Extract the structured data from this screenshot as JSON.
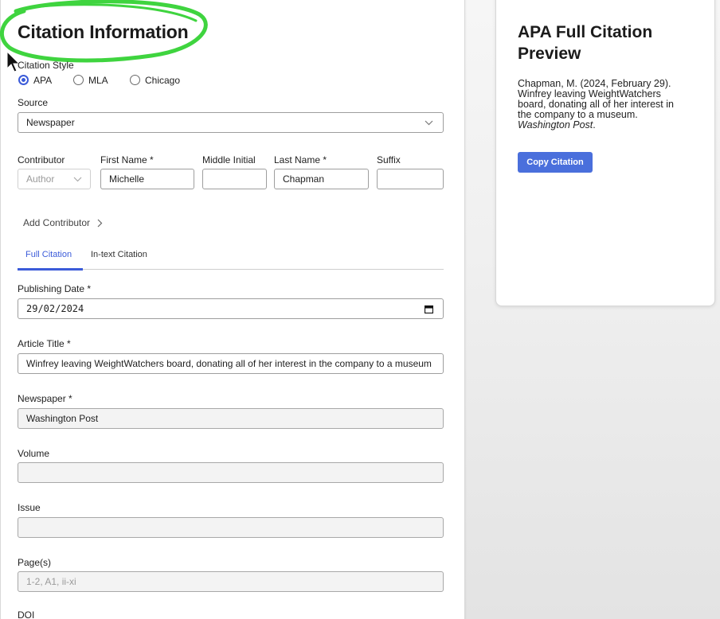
{
  "form": {
    "title": "Citation Information",
    "citation_style": {
      "label": "Citation Style",
      "options": [
        {
          "label": "APA",
          "checked": true
        },
        {
          "label": "MLA",
          "checked": false
        },
        {
          "label": "Chicago",
          "checked": false
        }
      ]
    },
    "source": {
      "label": "Source",
      "value": "Newspaper"
    },
    "contributor": {
      "label": "Contributor",
      "role_placeholder": "Author",
      "first_name_label": "First Name *",
      "first_name_value": "Michelle",
      "middle_initial_label": "Middle Initial",
      "middle_initial_value": "",
      "last_name_label": "Last Name *",
      "last_name_value": "Chapman",
      "suffix_label": "Suffix",
      "suffix_value": ""
    },
    "add_contributor": "Add Contributor",
    "tabs": [
      {
        "label": "Full Citation",
        "active": true
      },
      {
        "label": "In-text Citation",
        "active": false
      }
    ],
    "publishing_date": {
      "label": "Publishing Date *",
      "value": "29/02/2024"
    },
    "article_title": {
      "label": "Article Title *",
      "value": "Winfrey leaving WeightWatchers board, donating all of her interest in the company to a museum"
    },
    "newspaper": {
      "label": "Newspaper *",
      "value": "Washington Post"
    },
    "volume": {
      "label": "Volume",
      "value": ""
    },
    "issue": {
      "label": "Issue",
      "value": ""
    },
    "pages": {
      "label": "Page(s)",
      "placeholder": "1-2, A1, ii-xi"
    },
    "doi": {
      "label": "DOI"
    }
  },
  "preview": {
    "title": "APA Full Citation Preview",
    "citation_line1": "Chapman, M. (2024, February 29).",
    "citation_line2": "Winfrey leaving WeightWatchers",
    "citation_line3": "board, donating all of her interest in",
    "citation_line4": "the company to a museum.",
    "citation_italic": "Washington Post",
    "citation_end": ".",
    "copy_button": "Copy Citation"
  },
  "colors": {
    "accent": "#3b5bd9",
    "button": "#4a6fdc",
    "highlight_circle": "#3fd43f"
  }
}
